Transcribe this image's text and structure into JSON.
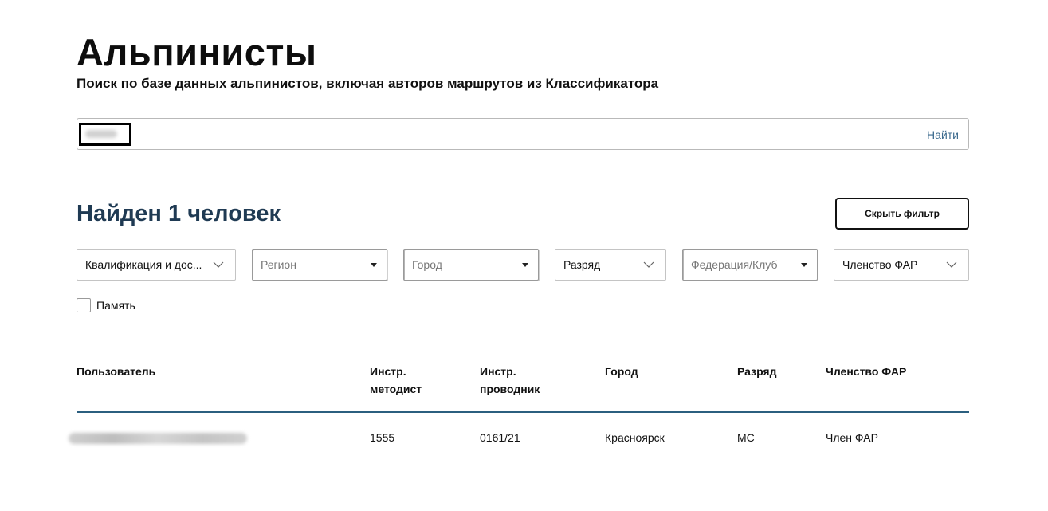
{
  "header": {
    "title": "Альпинисты",
    "subtitle": "Поиск по базе данных альпинистов, включая авторов маршрутов из Классификатора"
  },
  "search": {
    "value": "",
    "button_label": "Найти"
  },
  "results": {
    "title": "Найден 1 человек",
    "hide_filter_label": "Скрыть фильтр"
  },
  "filters": [
    {
      "label": "Квалификация и дос...",
      "kind": "chevron"
    },
    {
      "label": "Регион",
      "kind": "triangle",
      "placeholder": true
    },
    {
      "label": "Город",
      "kind": "triangle",
      "placeholder": true
    },
    {
      "label": "Разряд",
      "kind": "chevron"
    },
    {
      "label": "Федерация/Клуб",
      "kind": "triangle",
      "placeholder": true
    },
    {
      "label": "Членство ФАР",
      "kind": "chevron"
    }
  ],
  "memory_checkbox": {
    "label": "Память",
    "checked": false
  },
  "table": {
    "headers": {
      "user": "Пользователь",
      "methodist_1": "Инстр.",
      "methodist_2": "методист",
      "guide_1": "Инстр.",
      "guide_2": "проводник",
      "city": "Город",
      "rank": "Разряд",
      "membership": "Членство ФАР"
    },
    "rows": [
      {
        "user": "",
        "methodist": "1555",
        "guide": "0161/21",
        "city": "Красноярск",
        "rank": "МС",
        "membership": "Член ФАР"
      }
    ]
  },
  "colors": {
    "accent": "#1f3a53",
    "divider": "#2b5f7f",
    "link": "#3d6b8e"
  }
}
